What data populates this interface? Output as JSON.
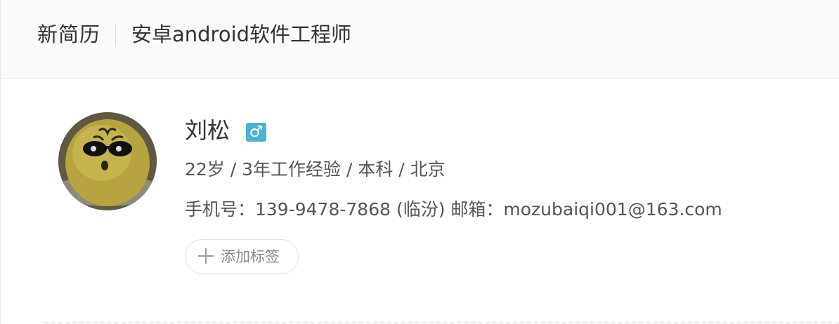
{
  "breadcrumb": {
    "root": "新简历",
    "current": "安卓android软件工程师"
  },
  "profile": {
    "name": "刘松",
    "gender_symbol": "♂",
    "info": "22岁 / 3年工作经验 / 本科 / 北京",
    "contact": "手机号：139-9478-7868 (临汾) 邮箱：mozubaiqi001@163.com",
    "add_tag_label": "添加标签"
  },
  "colors": {
    "gender_badge": "#4fb0d6",
    "header_bg": "#fafafa"
  },
  "icons": {
    "gender": "male-icon",
    "add": "plus-icon"
  }
}
